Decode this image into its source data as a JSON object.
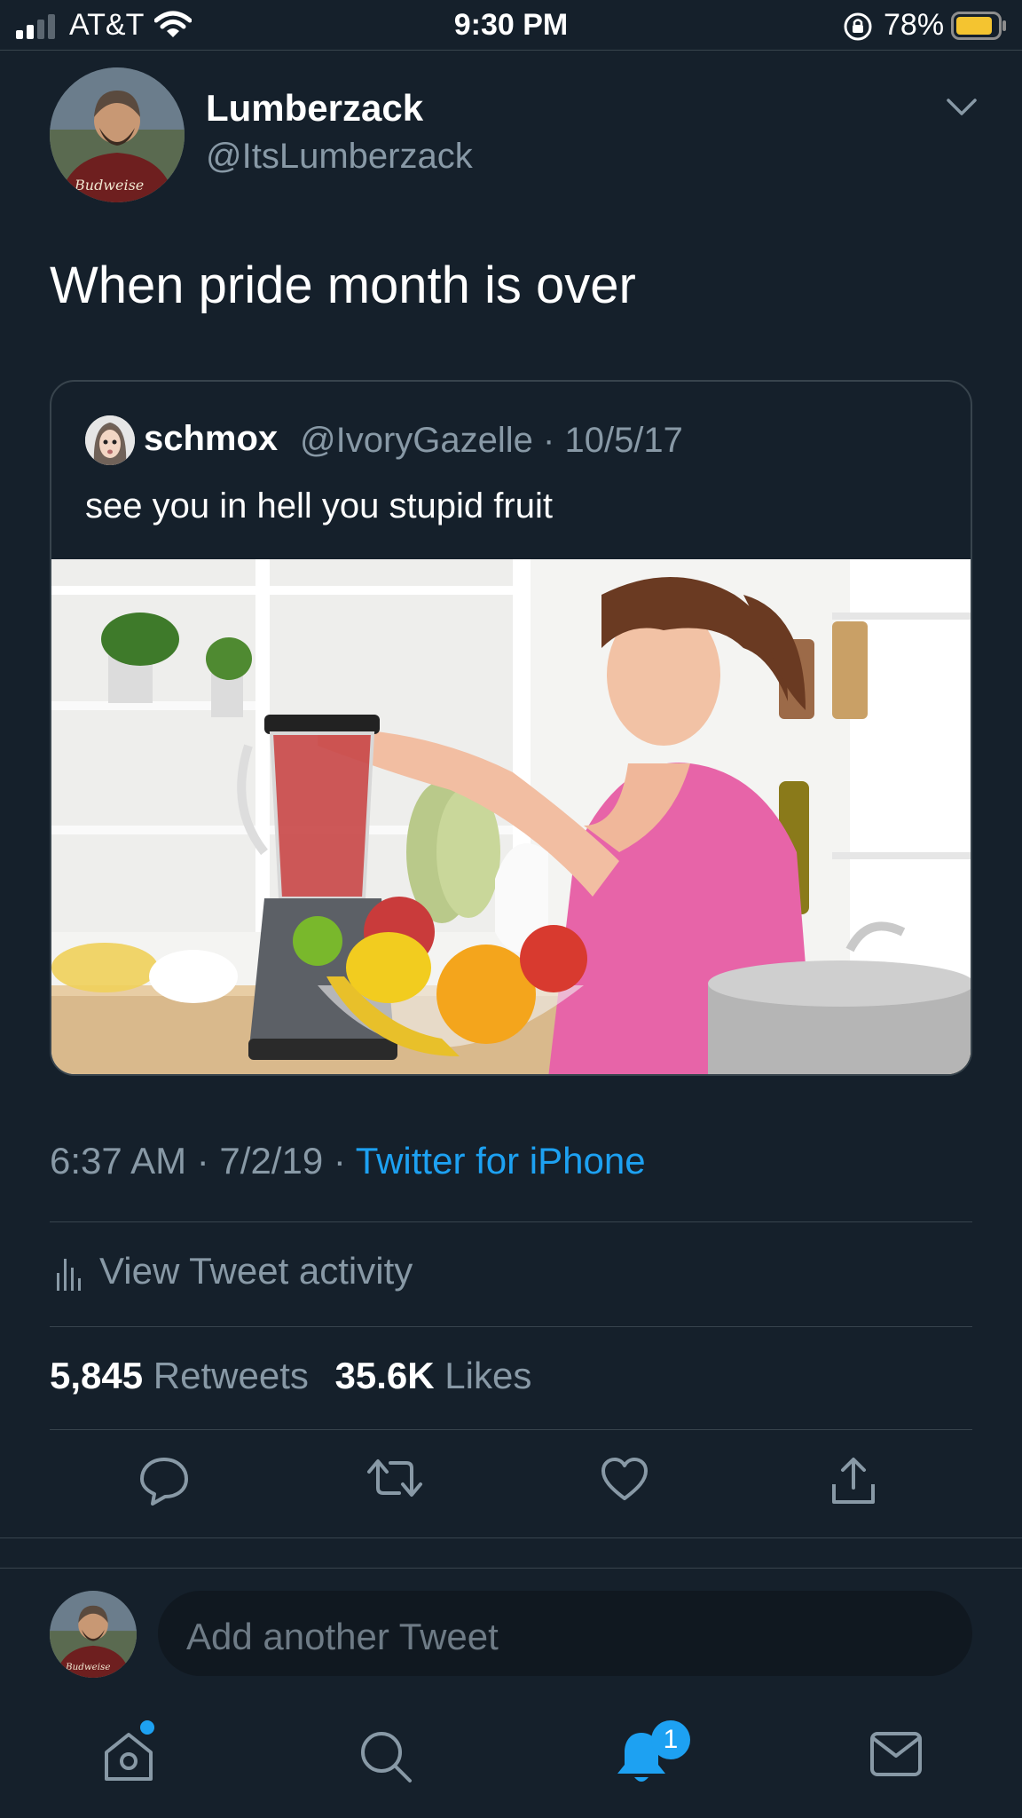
{
  "status_bar": {
    "carrier": "AT&T",
    "time": "9:30 PM",
    "battery_percent": "78%",
    "signal_bars": 2,
    "battery_level": 0.78
  },
  "tweet": {
    "display_name": "Lumberzack",
    "handle": "@ItsLumberzack",
    "text": "When pride month is over",
    "quote": {
      "display_name": "schmox",
      "meta": "@IvoryGazelle · 10/5/17",
      "text": "see you in hell you stupid fruit",
      "image_alt": "woman-using-blender-with-fruit-bowl"
    },
    "timestamp": "6:37 AM · 7/2/19 · ",
    "source": "Twitter for iPhone",
    "activity_label": "View Tweet activity",
    "retweets_count": "5,845",
    "retweets_label": "Retweets",
    "likes_count": "35.6K",
    "likes_label": "Likes"
  },
  "reply": {
    "placeholder": "Add another Tweet"
  },
  "tabbar": {
    "notifications_badge": "1",
    "items": [
      "home-icon",
      "search-icon",
      "notifications-icon",
      "messages-icon"
    ]
  },
  "colors": {
    "background": "#15202b",
    "accent": "#1da1f2",
    "secondary_text": "#8899a6",
    "divider": "#38444d"
  }
}
